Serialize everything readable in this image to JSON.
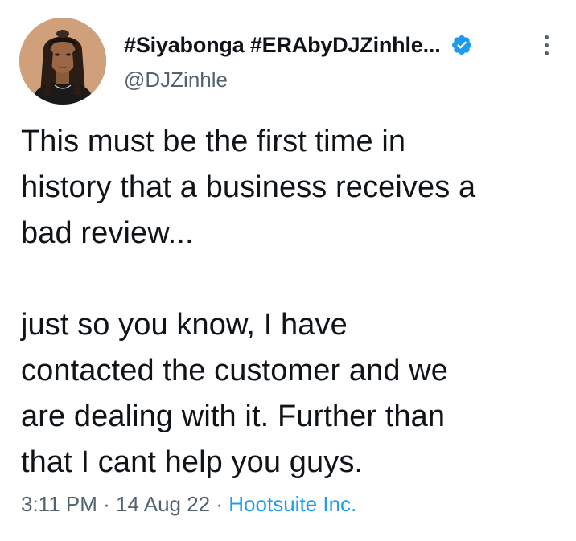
{
  "author": {
    "display_name": "#Siyabonga #ERAbyDJZinhle...",
    "handle": "@DJZinhle",
    "verified": true,
    "avatar_icon": "profile-photo",
    "verified_icon": "verified-badge-icon"
  },
  "menu": {
    "icon": "more-options-icon"
  },
  "tweet": {
    "lines": [
      "This must be the first time in",
      "history that a business receives a",
      "bad review...",
      "",
      "just so you know, I have",
      "contacted the customer and we",
      "are dealing with it. Further than",
      "that I cant help you guys."
    ]
  },
  "meta": {
    "time": "3:11 PM",
    "separator": "·",
    "date": "14 Aug 22",
    "source": "Hootsuite Inc."
  },
  "colors": {
    "text": "#0f1419",
    "secondary": "#536471",
    "link": "#1d9bf0",
    "divider": "#eff3f4"
  }
}
